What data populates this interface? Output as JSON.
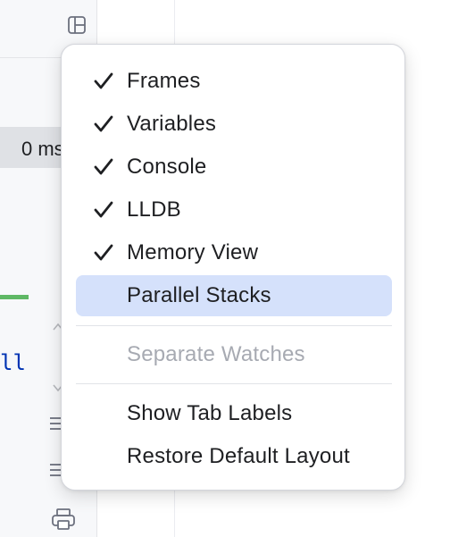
{
  "background": {
    "time_pill_text": "0 ms",
    "code_fragment": "ll",
    "layout_button_icon": "layout-icon",
    "print_button_icon": "print-icon"
  },
  "menu": {
    "items": [
      {
        "label": "Frames",
        "checked": true,
        "state": "normal",
        "check_icon": "check-icon"
      },
      {
        "label": "Variables",
        "checked": true,
        "state": "normal",
        "check_icon": "check-icon"
      },
      {
        "label": "Console",
        "checked": true,
        "state": "normal",
        "check_icon": "check-icon"
      },
      {
        "label": "LLDB",
        "checked": true,
        "state": "normal",
        "check_icon": "check-icon"
      },
      {
        "label": "Memory View",
        "checked": true,
        "state": "normal",
        "check_icon": "check-icon"
      },
      {
        "label": "Parallel Stacks",
        "checked": false,
        "state": "hovered"
      },
      {
        "label": "Separate Watches",
        "checked": false,
        "state": "disabled"
      },
      {
        "label": "Show Tab Labels",
        "checked": false,
        "state": "normal"
      },
      {
        "label": "Restore Default Layout",
        "checked": false,
        "state": "normal"
      }
    ]
  },
  "colors": {
    "highlight": "#d5e1fb",
    "text": "#1e1f22",
    "disabled_text": "#a7aab2",
    "accent_green": "#5fb865",
    "code_keyword": "#0033b3"
  }
}
